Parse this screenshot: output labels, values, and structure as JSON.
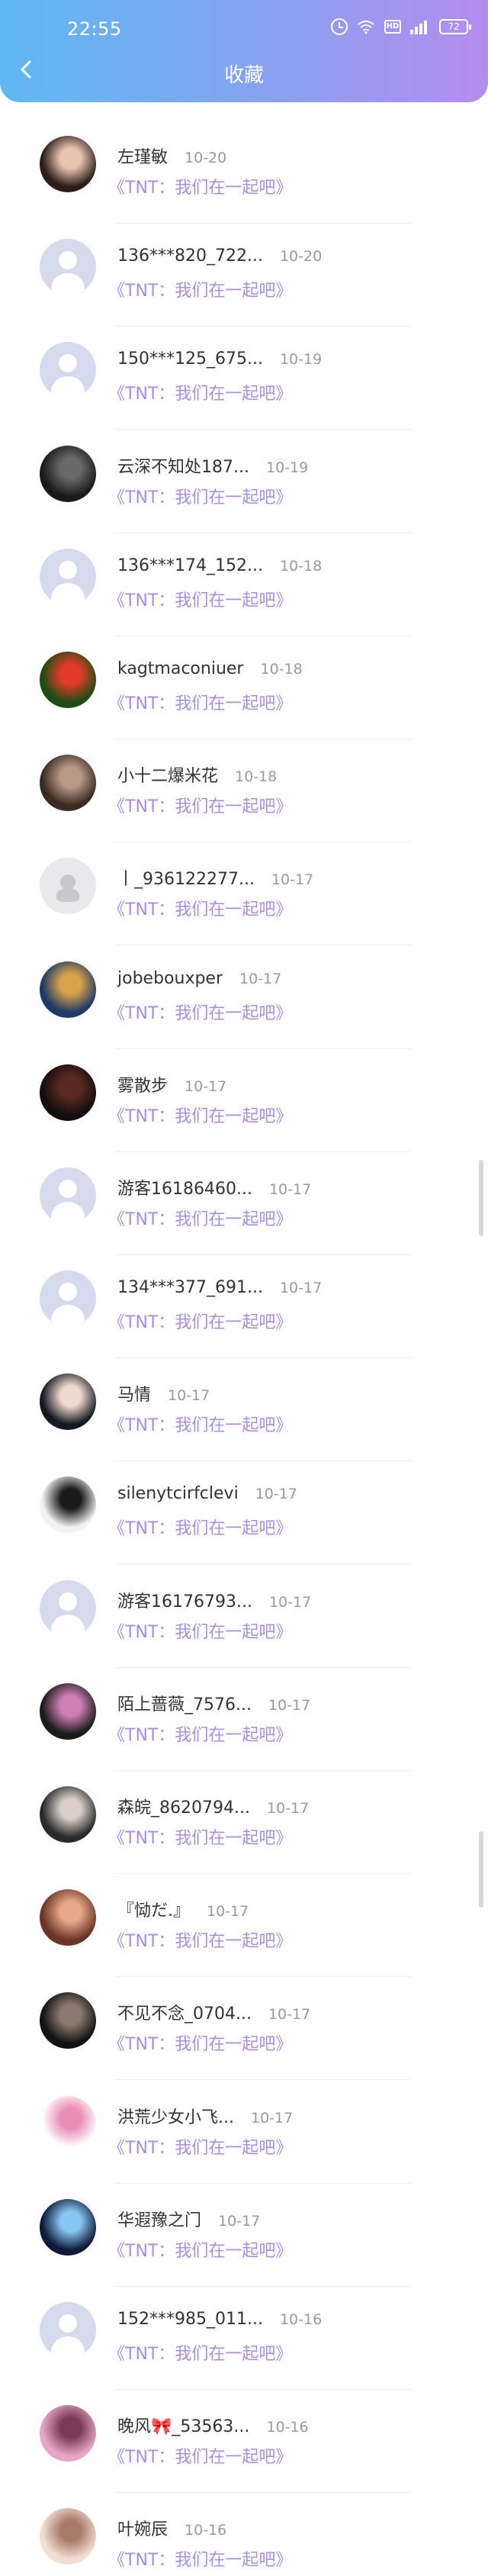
{
  "status_bar": {
    "time": "22:55",
    "battery": "72"
  },
  "header": {
    "title": "收藏"
  },
  "items": [
    {
      "name": "左瑾敏",
      "date": "10-20",
      "work": "《TNT：我们在一起吧》",
      "avatar": "photo",
      "colors": [
        "#2b1d18",
        "#e9c5b1"
      ]
    },
    {
      "name": "136***820_722...",
      "date": "10-20",
      "work": "《TNT：我们在一起吧》",
      "avatar": "default"
    },
    {
      "name": "150***125_675...",
      "date": "10-19",
      "work": "《TNT：我们在一起吧》",
      "avatar": "default"
    },
    {
      "name": "云深不知处187...",
      "date": "10-19",
      "work": "《TNT：我们在一起吧》",
      "avatar": "photo",
      "colors": [
        "#1a1a1a",
        "#6a6a6a"
      ]
    },
    {
      "name": "136***174_152...",
      "date": "10-18",
      "work": "《TNT：我们在一起吧》",
      "avatar": "default"
    },
    {
      "name": "kagtmaconiuer",
      "date": "10-18",
      "work": "《TNT：我们在一起吧》",
      "avatar": "photo",
      "colors": [
        "#1d4d12",
        "#e23b2a"
      ]
    },
    {
      "name": "小十二爆米花",
      "date": "10-18",
      "work": "《TNT：我们在一起吧》",
      "avatar": "photo",
      "colors": [
        "#3a2a22",
        "#b79a88"
      ]
    },
    {
      "name": "丨_936122277...",
      "date": "10-17",
      "work": "《TNT：我们在一起吧》",
      "avatar": "ghost"
    },
    {
      "name": "jobebouxper",
      "date": "10-17",
      "work": "《TNT：我们在一起吧》",
      "avatar": "photo",
      "colors": [
        "#1f3a66",
        "#d7a24a"
      ]
    },
    {
      "name": "雾散步",
      "date": "10-17",
      "work": "《TNT：我们在一起吧》",
      "avatar": "photo",
      "colors": [
        "#140d0d",
        "#5a2a22"
      ]
    },
    {
      "name": "游客16186460...",
      "date": "10-17",
      "work": "《TNT：我们在一起吧》",
      "avatar": "default"
    },
    {
      "name": "134***377_691...",
      "date": "10-17",
      "work": "《TNT：我们在一起吧》",
      "avatar": "default"
    },
    {
      "name": "马情",
      "date": "10-17",
      "work": "《TNT：我们在一起吧》",
      "avatar": "photo",
      "colors": [
        "#141a22",
        "#f0d9cf"
      ]
    },
    {
      "name": "silenytcirfclevi",
      "date": "10-17",
      "work": "《TNT：我们在一起吧》",
      "avatar": "photo",
      "colors": [
        "#f2f2f2",
        "#1a1a1a"
      ]
    },
    {
      "name": "游客16176793...",
      "date": "10-17",
      "work": "《TNT：我们在一起吧》",
      "avatar": "default"
    },
    {
      "name": "陌上蔷薇_7576...",
      "date": "10-17",
      "work": "《TNT：我们在一起吧》",
      "avatar": "photo",
      "colors": [
        "#1b1b1b",
        "#d07fb4"
      ]
    },
    {
      "name": "森皖_8620794...",
      "date": "10-17",
      "work": "《TNT：我们在一起吧》",
      "avatar": "photo",
      "colors": [
        "#2a2a2a",
        "#d9cfc7"
      ]
    },
    {
      "name": "『恸だ.』",
      "date": "10-17",
      "work": "《TNT：我们在一起吧》",
      "avatar": "photo",
      "colors": [
        "#6a3426",
        "#e8a88a"
      ]
    },
    {
      "name": "不见不念_0704...",
      "date": "10-17",
      "work": "《TNT：我们在一起吧》",
      "avatar": "photo",
      "colors": [
        "#121212",
        "#8a7a70"
      ]
    },
    {
      "name": "洪荒少女小飞...",
      "date": "10-17",
      "work": "《TNT：我们在一起吧》",
      "avatar": "photo",
      "colors": [
        "#ffffff",
        "#e88db6"
      ]
    },
    {
      "name": "华遐豫之门",
      "date": "10-17",
      "work": "《TNT：我们在一起吧》",
      "avatar": "photo",
      "colors": [
        "#0e1a3a",
        "#86c6f0"
      ]
    },
    {
      "name": "152***985_011...",
      "date": "10-16",
      "work": "《TNT：我们在一起吧》",
      "avatar": "default"
    },
    {
      "name": "晚风🎀_53563...",
      "date": "10-16",
      "work": "《TNT：我们在一起吧》",
      "avatar": "photo",
      "colors": [
        "#e7a6c6",
        "#7a3a5a"
      ]
    },
    {
      "name": "叶婉辰",
      "date": "10-16",
      "work": "《TNT：我们在一起吧》",
      "avatar": "photo",
      "colors": [
        "#f2ded2",
        "#a87a6a"
      ]
    }
  ]
}
